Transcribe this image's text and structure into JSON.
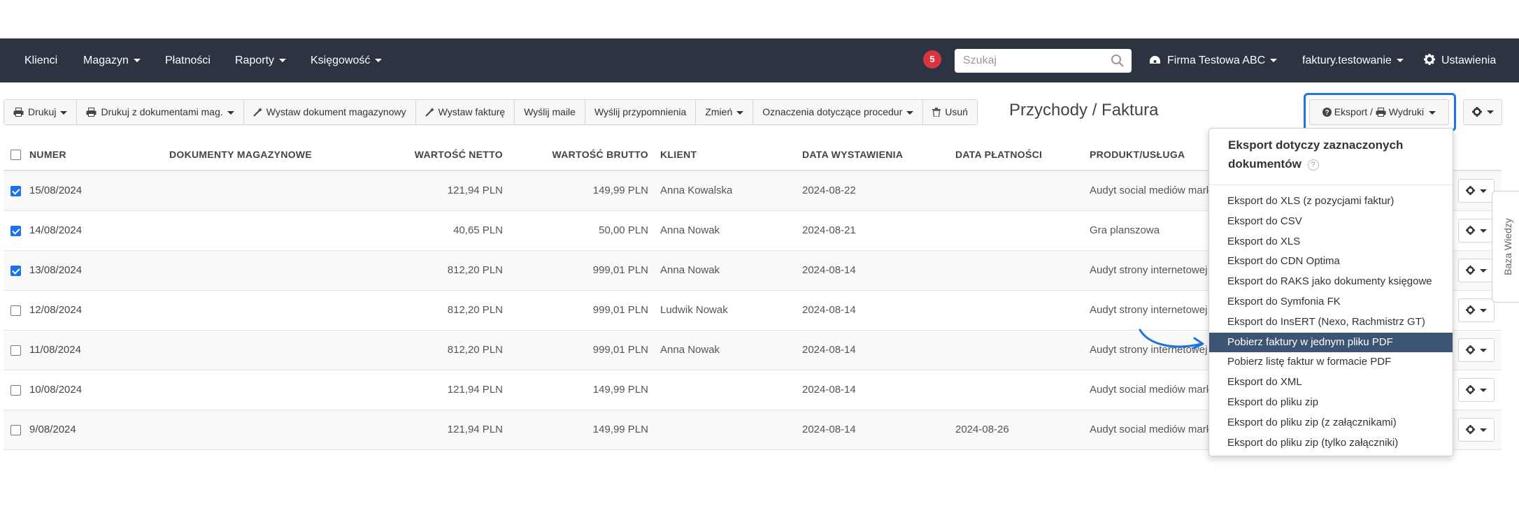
{
  "nav": {
    "items": [
      {
        "label": "Klienci",
        "caret": false
      },
      {
        "label": "Magazyn",
        "caret": true
      },
      {
        "label": "Płatności",
        "caret": false
      },
      {
        "label": "Raporty",
        "caret": true
      },
      {
        "label": "Księgowość",
        "caret": true
      }
    ],
    "notification_count": "5",
    "search_placeholder": "Szukaj",
    "company": "Firma Testowa ABC",
    "account": "faktury.testowanie",
    "settings": "Ustawienia"
  },
  "toolbar": {
    "buttons": [
      {
        "label": "Drukuj",
        "icon": "print-icon",
        "caret": true
      },
      {
        "label": "Drukuj z dokumentami mag.",
        "icon": "print-icon",
        "caret": true
      },
      {
        "label": "Wystaw dokument magazynowy",
        "icon": "wand-icon",
        "caret": false
      },
      {
        "label": "Wystaw fakturę",
        "icon": "wand-icon",
        "caret": false
      },
      {
        "label": "Wyślij maile",
        "icon": "",
        "caret": false
      },
      {
        "label": "Wyślij przypomnienia",
        "icon": "",
        "caret": false
      },
      {
        "label": "Zmień",
        "icon": "",
        "caret": true
      },
      {
        "label": "Oznaczenia dotyczące procedur",
        "icon": "",
        "caret": true
      },
      {
        "label": "Usuń",
        "icon": "trash-icon",
        "caret": false
      }
    ]
  },
  "page_title": "Przychody / Faktura",
  "export_button": {
    "label_left": "Eksport /",
    "label_right": "Wydruki"
  },
  "table": {
    "headers": {
      "numer": "NUMER",
      "dokumenty": "DOKUMENTY MAGAZYNOWE",
      "netto": "WARTOŚĆ NETTO",
      "brutto": "WARTOŚĆ BRUTTO",
      "klient": "KLIENT",
      "data_wyst": "DATA WYSTAWIENIA",
      "data_plat": "DATA PŁATNOŚCI",
      "produkt": "PRODUKT/USŁUGA"
    },
    "rows": [
      {
        "checked": true,
        "numer": "15/08/2024",
        "netto": "121,94 PLN",
        "brutto": "149,99 PLN",
        "klient": "Anna Kowalska",
        "data_wyst": "2024-08-22",
        "data_plat": "",
        "produkt": "Audyt social mediów marketing"
      },
      {
        "checked": true,
        "numer": "14/08/2024",
        "netto": "40,65 PLN",
        "brutto": "50,00 PLN",
        "klient": "Anna Nowak",
        "data_wyst": "2024-08-21",
        "data_plat": "",
        "produkt": "Gra planszowa"
      },
      {
        "checked": true,
        "numer": "13/08/2024",
        "netto": "812,20 PLN",
        "brutto": "999,01 PLN",
        "klient": "Anna Nowak",
        "data_wyst": "2024-08-14",
        "data_plat": "",
        "produkt": "Audyt strony internetowej"
      },
      {
        "checked": false,
        "numer": "12/08/2024",
        "netto": "812,20 PLN",
        "brutto": "999,01 PLN",
        "klient": "Ludwik Nowak",
        "data_wyst": "2024-08-14",
        "data_plat": "",
        "produkt": "Audyt strony internetowej"
      },
      {
        "checked": false,
        "numer": "11/08/2024",
        "netto": "812,20 PLN",
        "brutto": "999,01 PLN",
        "klient": "Anna Nowak",
        "data_wyst": "2024-08-14",
        "data_plat": "",
        "produkt": "Audyt strony internetowej"
      },
      {
        "checked": false,
        "numer": "10/08/2024",
        "netto": "121,94 PLN",
        "brutto": "149,99 PLN",
        "klient": "",
        "data_wyst": "2024-08-14",
        "data_plat": "",
        "produkt": "Audyt social mediów marketing"
      },
      {
        "checked": false,
        "numer": "9/08/2024",
        "netto": "121,94 PLN",
        "brutto": "149,99 PLN",
        "klient": "",
        "data_wyst": "2024-08-14",
        "data_plat": "2024-08-26",
        "produkt": "Audyt social mediów marketing"
      }
    ]
  },
  "dropdown": {
    "heading": "Eksport dotyczy zaznaczonych dokumentów",
    "help": "?",
    "items": [
      {
        "label": "Eksport do XLS (z pozycjami faktur)",
        "active": false
      },
      {
        "label": "Eksport do CSV",
        "active": false
      },
      {
        "label": "Eksport do XLS",
        "active": false
      },
      {
        "label": "Eksport do CDN Optima",
        "active": false
      },
      {
        "label": "Eksport do RAKS jako dokumenty księgowe",
        "active": false
      },
      {
        "label": "Eksport do Symfonia FK",
        "active": false
      },
      {
        "label": "Eksport do InsERT (Nexo, Rachmistrz GT)",
        "active": false
      },
      {
        "label": "Pobierz faktury w jednym pliku PDF",
        "active": true
      },
      {
        "label": "Pobierz listę faktur w formacie PDF",
        "active": false
      },
      {
        "label": "Eksport do XML",
        "active": false
      },
      {
        "label": "Eksport do pliku zip",
        "active": false
      },
      {
        "label": "Eksport do pliku zip (z załącznikami)",
        "active": false
      },
      {
        "label": "Eksport do pliku zip (tylko załączniki)",
        "active": false
      }
    ]
  },
  "side_tab": "Baza Wiedzy",
  "colors": {
    "navbar": "#2b3440",
    "highlight": "#1f73e0",
    "active_item": "#3c5575",
    "badge": "#d9343f",
    "checkbox": "#1a73e8"
  }
}
